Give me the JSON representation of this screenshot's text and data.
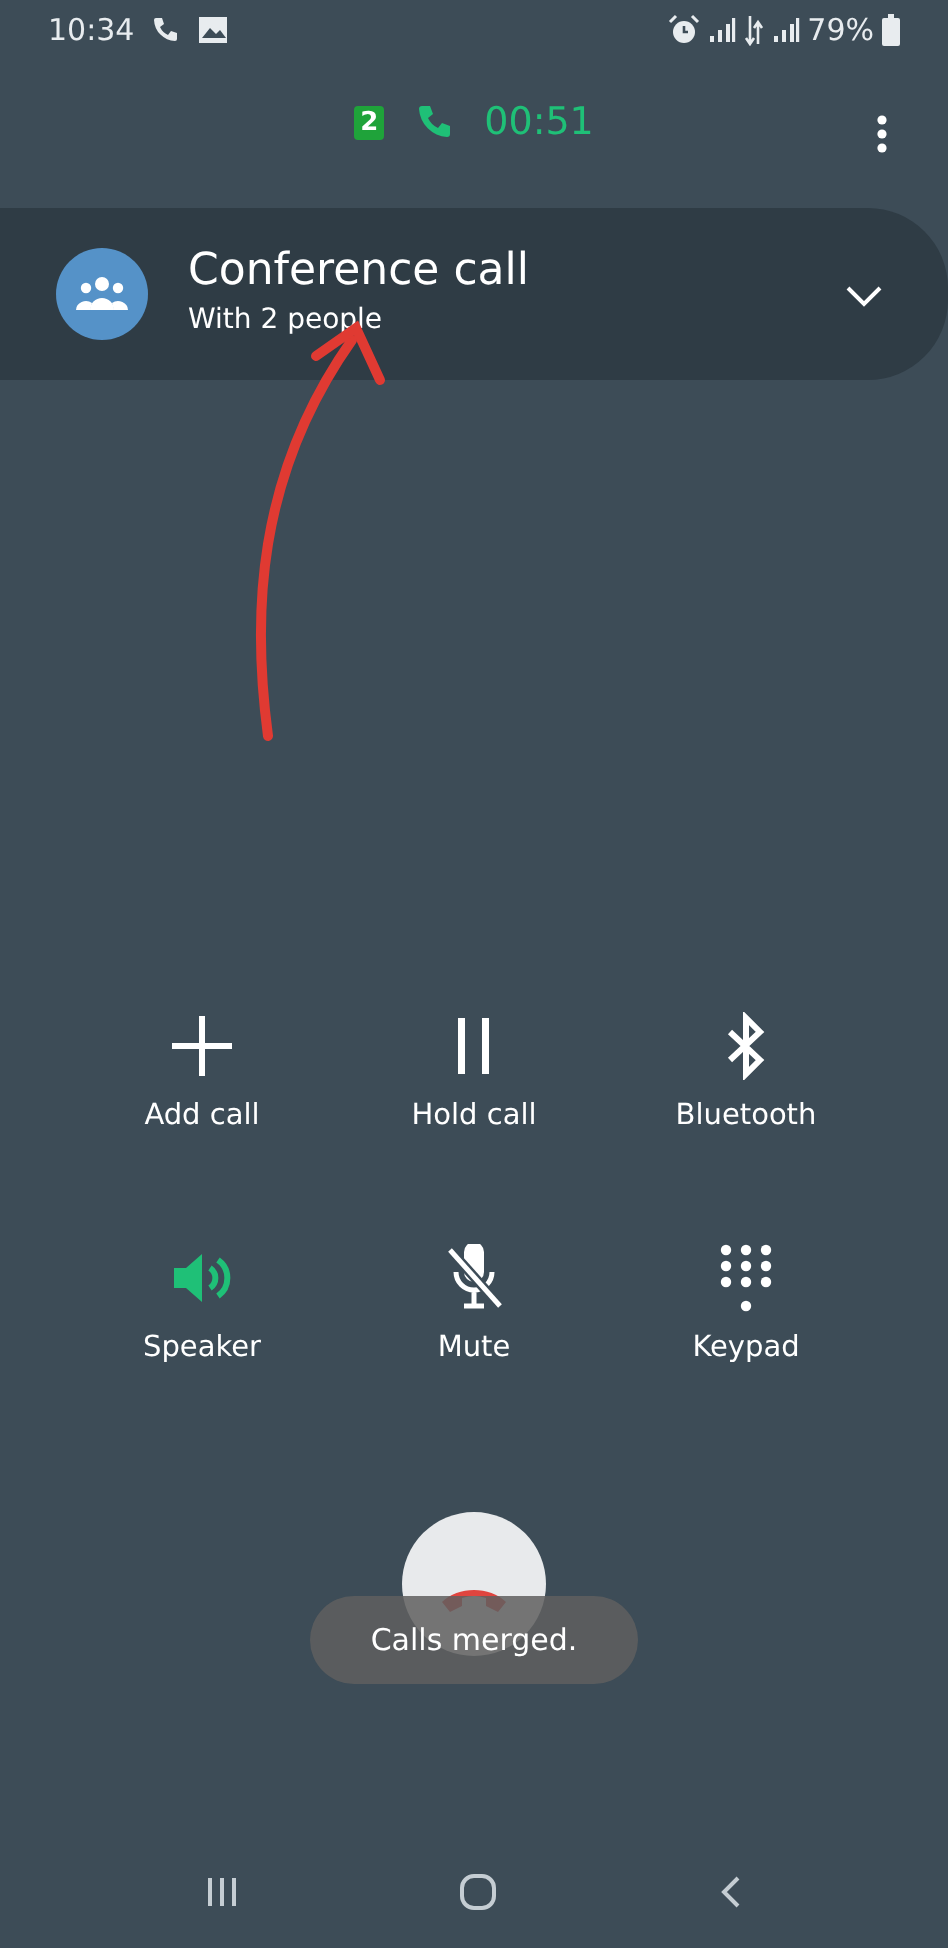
{
  "status_bar": {
    "time": "10:34",
    "battery": "79%"
  },
  "call_header": {
    "sim": "2",
    "duration": "00:51"
  },
  "conference": {
    "title": "Conference call",
    "subtitle": "With 2 people",
    "expanded": false
  },
  "buttons": [
    {
      "kind": "add",
      "label": "Add call",
      "on": false
    },
    {
      "kind": "hold",
      "label": "Hold call",
      "on": false
    },
    {
      "kind": "bluetooth",
      "label": "Bluetooth",
      "on": false
    },
    {
      "kind": "speaker",
      "label": "Speaker",
      "on": true
    },
    {
      "kind": "mute",
      "label": "Mute",
      "on": false
    },
    {
      "kind": "keypad",
      "label": "Keypad",
      "on": false
    }
  ],
  "toast": "Calls merged."
}
